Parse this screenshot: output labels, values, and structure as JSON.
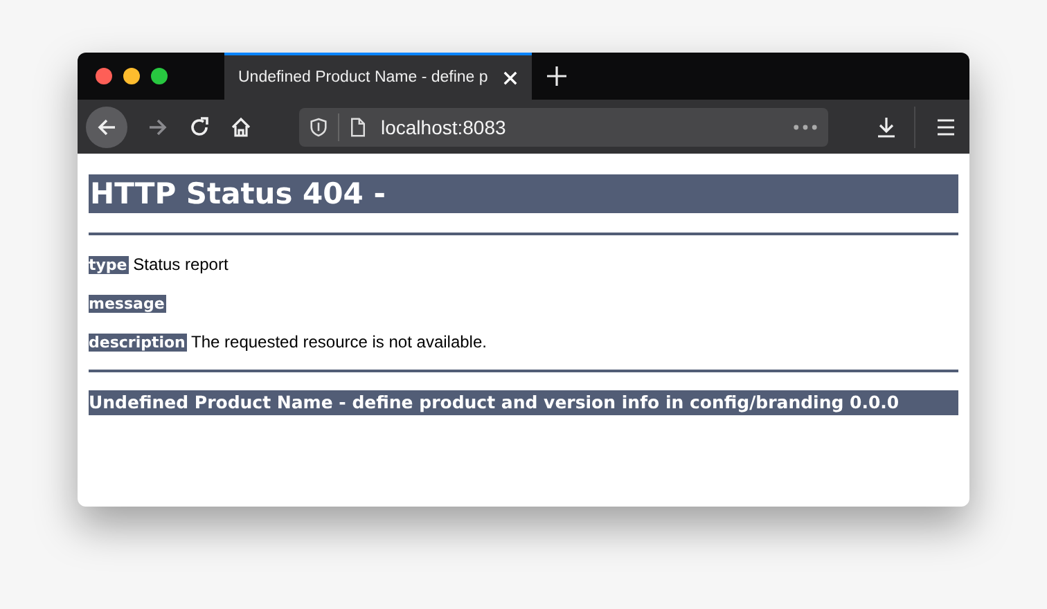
{
  "browser": {
    "tab_title": "Undefined Product Name - define p",
    "url": "localhost:8083"
  },
  "page": {
    "heading": "HTTP Status 404 -",
    "fields": [
      {
        "label": "type",
        "value": "Status report"
      },
      {
        "label": "message"
      },
      {
        "label": "description",
        "value": "The requested resource is not available."
      }
    ],
    "footer": "Undefined Product Name - define product and version info in config/branding 0.0.0"
  }
}
